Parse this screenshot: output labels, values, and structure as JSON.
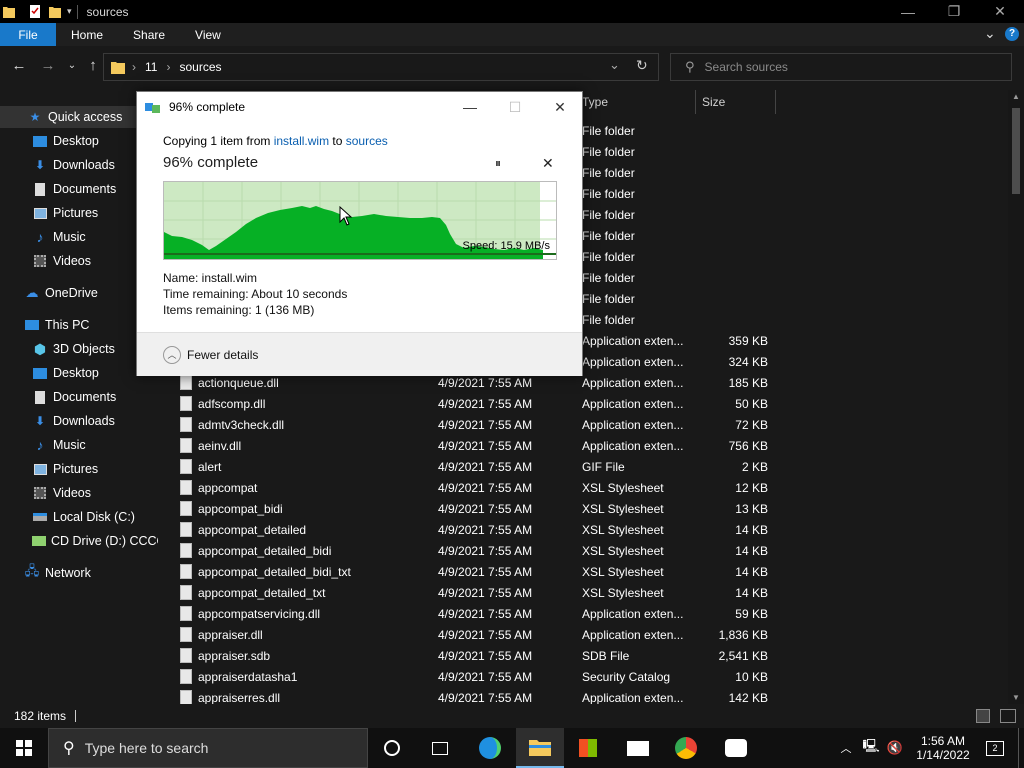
{
  "window": {
    "title": "sources",
    "minimize": "—",
    "restore": "❐",
    "close": "✕"
  },
  "ribbon": {
    "file": "File",
    "home": "Home",
    "share": "Share",
    "view": "View",
    "expand": "⌄",
    "help": "?"
  },
  "address": {
    "crumb1": "11",
    "crumb2": "sources",
    "chevron": "›"
  },
  "search": {
    "placeholder": "Search sources"
  },
  "nav": {
    "quick_access": "Quick access",
    "desktop": "Desktop",
    "downloads": "Downloads",
    "documents": "Documents",
    "pictures": "Pictures",
    "music": "Music",
    "videos": "Videos",
    "onedrive": "OneDrive",
    "this_pc": "This PC",
    "objects3d": "3D Objects",
    "pc_desktop": "Desktop",
    "pc_documents": "Documents",
    "pc_downloads": "Downloads",
    "pc_music": "Music",
    "pc_pictures": "Pictures",
    "pc_videos": "Videos",
    "local_disk": "Local Disk (C:)",
    "cd_drive": "CD Drive (D:) CCCO",
    "network": "Network"
  },
  "columns": {
    "type": "Type",
    "size": "Size"
  },
  "files": [
    {
      "name": "",
      "date": "",
      "type": "File folder",
      "size": ""
    },
    {
      "name": "",
      "date": "",
      "type": "File folder",
      "size": ""
    },
    {
      "name": "",
      "date": "",
      "type": "File folder",
      "size": ""
    },
    {
      "name": "",
      "date": "",
      "type": "File folder",
      "size": ""
    },
    {
      "name": "",
      "date": "",
      "type": "File folder",
      "size": ""
    },
    {
      "name": "",
      "date": "",
      "type": "File folder",
      "size": ""
    },
    {
      "name": "",
      "date": "",
      "type": "File folder",
      "size": ""
    },
    {
      "name": "",
      "date": "",
      "type": "File folder",
      "size": ""
    },
    {
      "name": "",
      "date": "",
      "type": "File folder",
      "size": ""
    },
    {
      "name": "",
      "date": "",
      "type": "File folder",
      "size": ""
    },
    {
      "name": "",
      "date": "",
      "type": "Application exten...",
      "size": "359 KB"
    },
    {
      "name": "",
      "date": "",
      "type": "Application exten...",
      "size": "324 KB"
    },
    {
      "name": "actionqueue.dll",
      "date": "4/9/2021 7:55 AM",
      "type": "Application exten...",
      "size": "185 KB"
    },
    {
      "name": "adfscomp.dll",
      "date": "4/9/2021 7:55 AM",
      "type": "Application exten...",
      "size": "50 KB"
    },
    {
      "name": "admtv3check.dll",
      "date": "4/9/2021 7:55 AM",
      "type": "Application exten...",
      "size": "72 KB"
    },
    {
      "name": "aeinv.dll",
      "date": "4/9/2021 7:55 AM",
      "type": "Application exten...",
      "size": "756 KB"
    },
    {
      "name": "alert",
      "date": "4/9/2021 7:55 AM",
      "type": "GIF File",
      "size": "2 KB"
    },
    {
      "name": "appcompat",
      "date": "4/9/2021 7:55 AM",
      "type": "XSL Stylesheet",
      "size": "12 KB"
    },
    {
      "name": "appcompat_bidi",
      "date": "4/9/2021 7:55 AM",
      "type": "XSL Stylesheet",
      "size": "13 KB"
    },
    {
      "name": "appcompat_detailed",
      "date": "4/9/2021 7:55 AM",
      "type": "XSL Stylesheet",
      "size": "14 KB"
    },
    {
      "name": "appcompat_detailed_bidi",
      "date": "4/9/2021 7:55 AM",
      "type": "XSL Stylesheet",
      "size": "14 KB"
    },
    {
      "name": "appcompat_detailed_bidi_txt",
      "date": "4/9/2021 7:55 AM",
      "type": "XSL Stylesheet",
      "size": "14 KB"
    },
    {
      "name": "appcompat_detailed_txt",
      "date": "4/9/2021 7:55 AM",
      "type": "XSL Stylesheet",
      "size": "14 KB"
    },
    {
      "name": "appcompatservicing.dll",
      "date": "4/9/2021 7:55 AM",
      "type": "Application exten...",
      "size": "59 KB"
    },
    {
      "name": "appraiser.dll",
      "date": "4/9/2021 7:55 AM",
      "type": "Application exten...",
      "size": "1,836 KB"
    },
    {
      "name": "appraiser.sdb",
      "date": "4/9/2021 7:55 AM",
      "type": "SDB File",
      "size": "2,541 KB"
    },
    {
      "name": "appraiserdatasha1",
      "date": "4/9/2021 7:55 AM",
      "type": "Security Catalog",
      "size": "10 KB"
    },
    {
      "name": "appraiserres.dll",
      "date": "4/9/2021 7:55 AM",
      "type": "Application exten...",
      "size": "142 KB"
    }
  ],
  "status": {
    "items": "182 items"
  },
  "dialog": {
    "title": "96% complete",
    "copy_prefix": "Copying 1 item from ",
    "source": "install.wim",
    "copy_mid": " to ",
    "dest": "sources",
    "percent_text": "96% complete",
    "progress": 0.96,
    "speed": "Speed: 15.9 MB/s",
    "pause": "⏸",
    "cancel": "✕",
    "name_line": "Name:  install.wim",
    "time_line": "Time remaining:  About 10 seconds",
    "items_line": "Items remaining:  1 (136 MB)",
    "fewer": "Fewer details",
    "min": "—",
    "max": "☐",
    "close": "✕"
  },
  "taskbar": {
    "search_placeholder": "Type here to search",
    "time": "1:56 AM",
    "date": "1/14/2022",
    "notifications": "2"
  },
  "colors": {
    "accent": "#1979ca",
    "graph_fill": "#06b025",
    "graph_bg": "#cde9c3",
    "link": "#0a5fb0"
  }
}
